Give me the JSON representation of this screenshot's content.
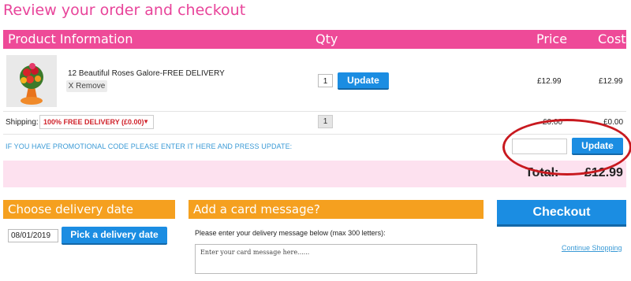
{
  "page": {
    "title": "Review your order and checkout"
  },
  "table_header": {
    "product": "Product Information",
    "qty": "Qty",
    "price": "Price",
    "cost": "Cost"
  },
  "item": {
    "name": "12 Beautiful Roses Galore-FREE DELIVERY",
    "remove_label": "X Remove",
    "qty": "1",
    "update_label": "Update",
    "price": "£12.99",
    "cost": "£12.99"
  },
  "shipping": {
    "label": "Shipping:",
    "selected": "100% FREE DELIVERY (£0.00)",
    "qty": "1",
    "price": "£0.00",
    "cost": "£0.00"
  },
  "promo": {
    "prompt": "IF YOU HAVE PROMOTIONAL CODE PLEASE ENTER IT HERE AND PRESS UPDATE:",
    "value": "",
    "update_label": "Update"
  },
  "total": {
    "label": "Total:",
    "value": "£12.99"
  },
  "delivery": {
    "header": "Choose delivery date",
    "date_value": "08/01/2019",
    "pick_label": "Pick a delivery date"
  },
  "card": {
    "header": "Add a card message?",
    "instruction": "Please enter your delivery message below (max 300 letters):",
    "placeholder": "Enter your card message here......"
  },
  "checkout": {
    "label": "Checkout",
    "continue_label": "Continue Shopping"
  },
  "colors": {
    "accent_pink": "#ee4a98",
    "accent_orange": "#f5a01f",
    "button_blue": "#1b8de2",
    "annotation_red": "#c8191f"
  }
}
